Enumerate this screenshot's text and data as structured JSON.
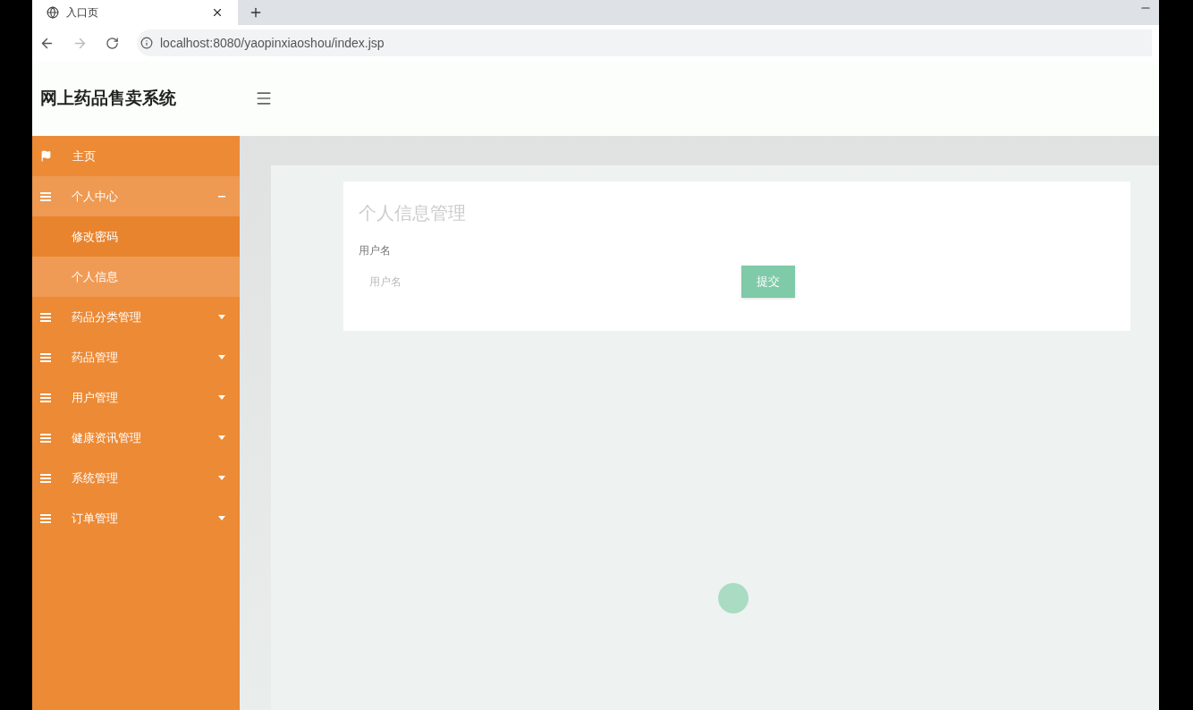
{
  "browser": {
    "tab_title": "入口页",
    "address": "localhost:8080/yaopinxiaoshou/index.jsp"
  },
  "header": {
    "title": "网上药品售卖系统"
  },
  "sidebar": {
    "items": [
      {
        "label": "主页",
        "kind": "flag",
        "expanded": false,
        "selected": false
      },
      {
        "label": "个人中心",
        "kind": "menu",
        "expanded": true,
        "selected": false,
        "children": [
          {
            "label": "修改密码",
            "selected": false
          },
          {
            "label": "个人信息",
            "selected": true
          }
        ]
      },
      {
        "label": "药品分类管理",
        "kind": "menu",
        "expanded": false,
        "selected": false
      },
      {
        "label": "药品管理",
        "kind": "menu",
        "expanded": false,
        "selected": false
      },
      {
        "label": "用户管理",
        "kind": "menu",
        "expanded": false,
        "selected": false
      },
      {
        "label": "健康资讯管理",
        "kind": "menu",
        "expanded": false,
        "selected": false
      },
      {
        "label": "系统管理",
        "kind": "menu",
        "expanded": false,
        "selected": false
      },
      {
        "label": "订单管理",
        "kind": "menu",
        "expanded": false,
        "selected": false
      }
    ]
  },
  "form": {
    "title": "个人信息管理",
    "field_label": "用户名",
    "placeholder": "用户名",
    "submit": "提交"
  }
}
